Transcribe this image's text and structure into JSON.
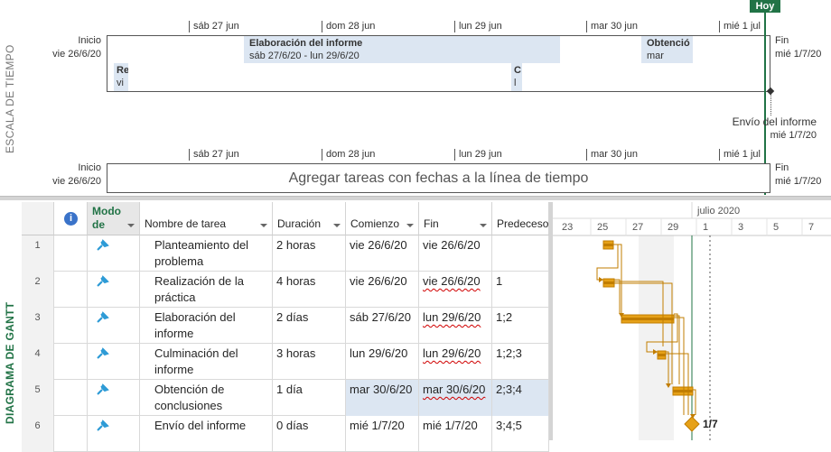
{
  "timeline": {
    "section_label": "ESCALA DE TIEMPO",
    "today_label": "Hoy",
    "ticks": [
      "sáb 27 jun",
      "dom 28 jun",
      "lun 29 jun",
      "mar 30 jun",
      "mié 1 jul"
    ],
    "start_label": "Inicio",
    "start_date": "vie 26/6/20",
    "finish_label": "Fin",
    "finish_date": "mié 1/7/20",
    "bars": [
      {
        "title": "Elaboración del informe",
        "dates": "sáb 27/6/20 - lun 29/6/20"
      },
      {
        "title": "Obtenció",
        "dates": "mar"
      },
      {
        "title": "Re",
        "dates": "vi"
      },
      {
        "title": "C",
        "dates": "l"
      }
    ],
    "milestone_title": "Envío del informe",
    "milestone_date": "mié 1/7/20",
    "placeholder": "Agregar tareas con fechas a la línea de tiempo"
  },
  "gantt": {
    "section_label": "DIAGRAMA DE GANTT",
    "columns": {
      "info": "i",
      "mode": "Modo de",
      "name": "Nombre de tarea",
      "duration": "Duración",
      "start": "Comienzo",
      "finish": "Fin",
      "pred": "Predeceso"
    },
    "rows": [
      {
        "id": "1",
        "name1": "Planteamiento del",
        "name2": "problema",
        "duration": "2 horas",
        "start": "vie 26/6/20",
        "finish": "vie 26/6/20",
        "pred": ""
      },
      {
        "id": "2",
        "name1": "Realización de la",
        "name2": "práctica",
        "duration": "4 horas",
        "start": "vie 26/6/20",
        "finish": "vie 26/6/20",
        "pred": "1"
      },
      {
        "id": "3",
        "name1": "Elaboración del",
        "name2": "informe",
        "duration": "2 días",
        "start": "sáb 27/6/20",
        "finish": "lun 29/6/20",
        "pred": "1;2"
      },
      {
        "id": "4",
        "name1": "Culminación del",
        "name2": "informe",
        "duration": "3 horas",
        "start": "lun 29/6/20",
        "finish": "lun 29/6/20",
        "pred": "1;2;3"
      },
      {
        "id": "5",
        "name1": "Obtención de",
        "name2": "conclusiones",
        "duration": "1 día",
        "start": "mar 30/6/20",
        "finish": "mar 30/6/20",
        "pred": "2;3;4"
      },
      {
        "id": "6",
        "name1": "Envío del informe",
        "name2": "",
        "duration": "0 días",
        "start": "mié 1/7/20",
        "finish": "mié 1/7/20",
        "pred": "3;4;5"
      }
    ],
    "chart_month": "julio 2020",
    "chart_days": [
      "23",
      "25",
      "27",
      "29",
      "1",
      "3",
      "5",
      "7"
    ],
    "milestone_label": "1/7"
  },
  "colors": {
    "accent": "#217346",
    "bar": "#e6a118",
    "bar_dark": "#c17d00",
    "timeline_bar": "#dce6f2"
  }
}
